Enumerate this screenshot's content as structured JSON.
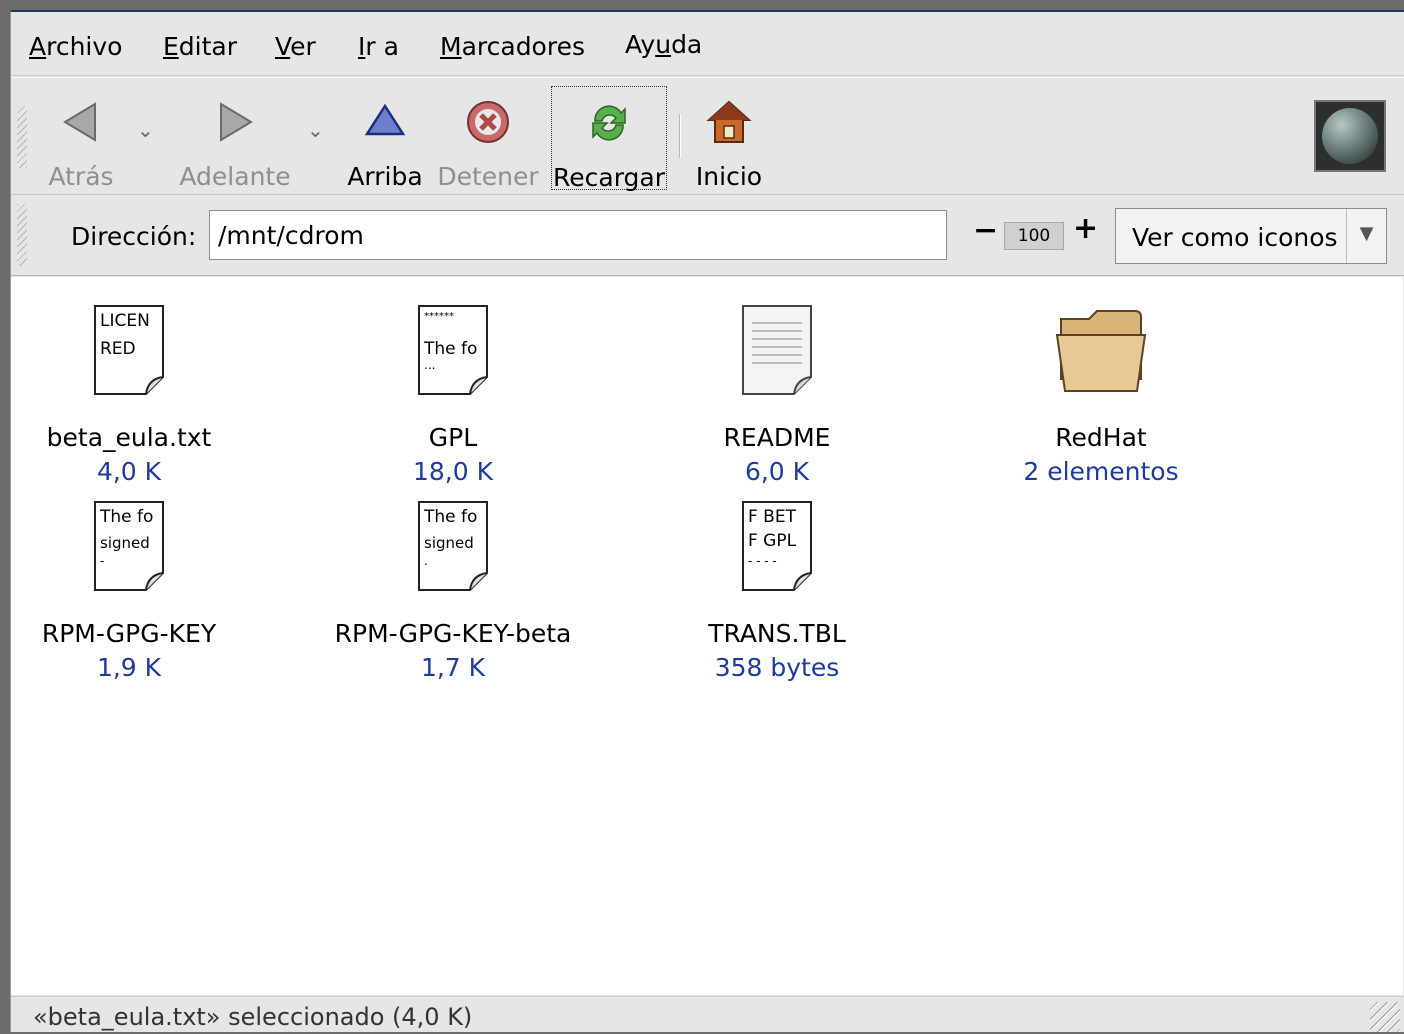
{
  "menu": {
    "archivo": {
      "u": "A",
      "rest": "rchivo"
    },
    "editar": {
      "u": "E",
      "rest": "ditar"
    },
    "ver": {
      "u": "V",
      "rest": "er"
    },
    "ira": {
      "u": "I",
      "rest": "r a"
    },
    "marcadores": {
      "u": "M",
      "rest": "arcadores"
    },
    "ayuda": {
      "pre": "Ay",
      "u": "u",
      "rest": "da"
    }
  },
  "toolbar": {
    "back": "Atrás",
    "forward": "Adelante",
    "up": "Arriba",
    "stop": "Detener",
    "reload": "Recargar",
    "home": "Inicio"
  },
  "location": {
    "label": "Dirección:",
    "value": "/mnt/cdrom",
    "zoom": "100",
    "view_as": "Ver como iconos"
  },
  "files": [
    {
      "name": "beta_eula.txt",
      "size": "4,0 K",
      "preview": [
        "LICEN",
        "RED"
      ]
    },
    {
      "name": "GPL",
      "size": "18,0 K",
      "preview": [
        "******",
        "The fo",
        "  ..."
      ]
    },
    {
      "name": "README",
      "size": "6,0 K"
    },
    {
      "name": "RedHat",
      "size": "2 elementos"
    },
    {
      "name": "RPM-GPG-KEY",
      "size": "1,9 K",
      "preview": [
        "The fo",
        "signed",
        "-"
      ]
    },
    {
      "name": "RPM-GPG-KEY-beta",
      "size": "1,7 K",
      "preview": [
        "The fo",
        "signed",
        "  ."
      ]
    },
    {
      "name": "TRANS.TBL",
      "size": "358 bytes",
      "preview": [
        "F BET",
        "F GPL",
        "- - - -"
      ]
    }
  ],
  "status": "«beta_eula.txt» seleccionado (4,0 K)",
  "colors": {
    "size_text": "#1e3a9c",
    "title_bar": "#1e3a5c",
    "folder": "#e8c894"
  }
}
